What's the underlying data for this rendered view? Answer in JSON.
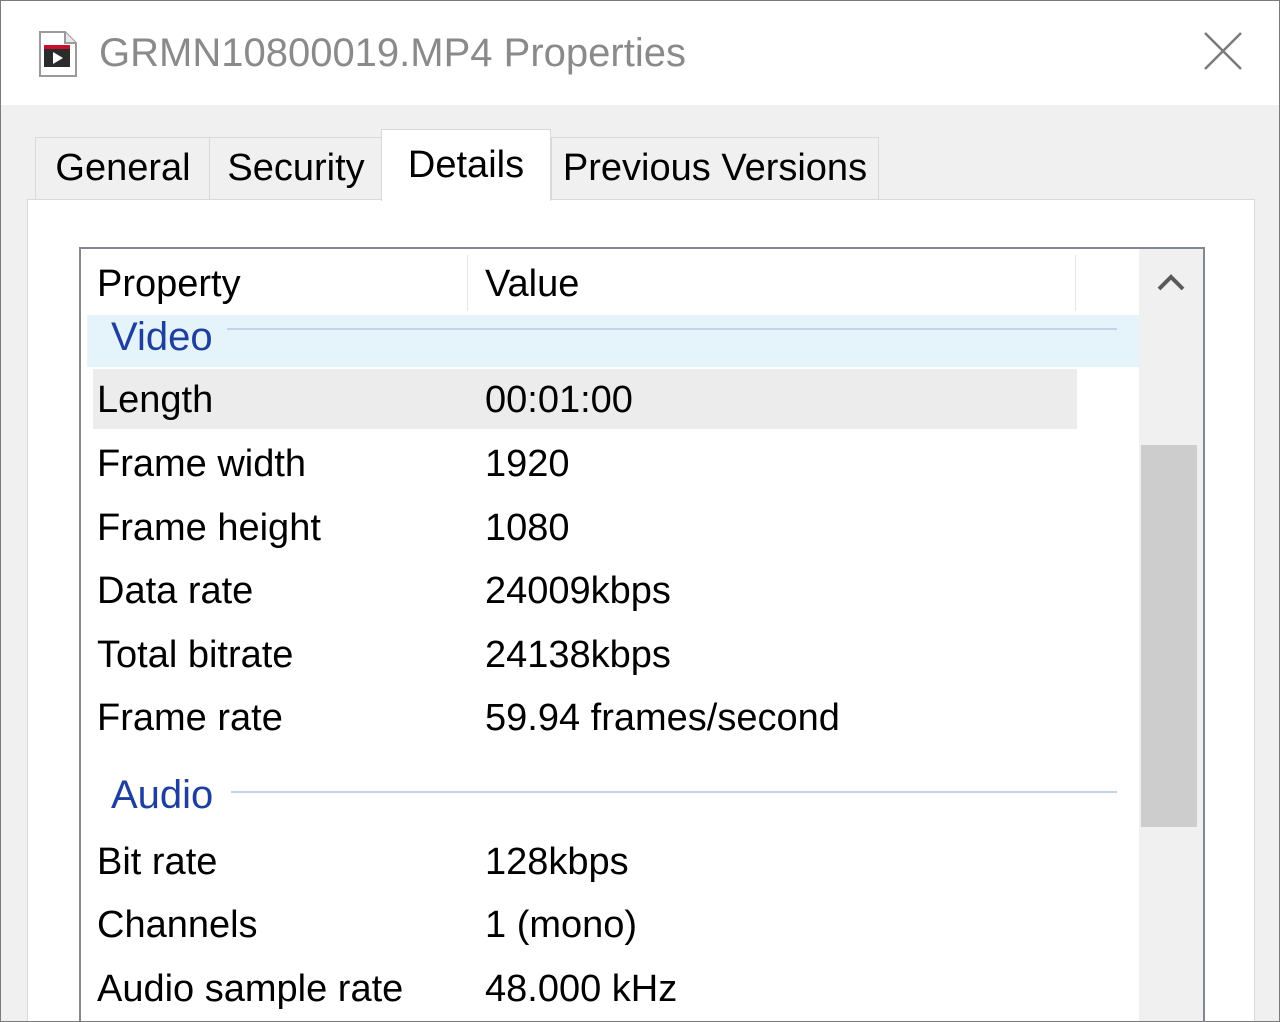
{
  "window": {
    "title": "GRMN10800019.MP4 Properties"
  },
  "tabs": [
    {
      "label": "General"
    },
    {
      "label": "Security"
    },
    {
      "label": "Details"
    },
    {
      "label": "Previous Versions"
    }
  ],
  "list": {
    "columns": {
      "property": "Property",
      "value": "Value"
    },
    "groups": {
      "video": {
        "label": "Video",
        "rows": [
          {
            "property": "Length",
            "value": "00:01:00"
          },
          {
            "property": "Frame width",
            "value": "1920"
          },
          {
            "property": "Frame height",
            "value": "1080"
          },
          {
            "property": "Data rate",
            "value": "24009kbps"
          },
          {
            "property": "Total bitrate",
            "value": "24138kbps"
          },
          {
            "property": "Frame rate",
            "value": "59.94 frames/second"
          }
        ]
      },
      "audio": {
        "label": "Audio",
        "rows": [
          {
            "property": "Bit rate",
            "value": "128kbps"
          },
          {
            "property": "Channels",
            "value": "1 (mono)"
          },
          {
            "property": "Audio sample rate",
            "value": "48.000 kHz"
          }
        ]
      }
    }
  },
  "icons": {
    "file": "video-file-icon",
    "close": "close-icon",
    "scroll_up": "chevron-up-icon"
  },
  "colors": {
    "group_header_text": "#1e3f9e",
    "group_highlight": "#e5f3fb",
    "selected_row": "#ececec"
  }
}
